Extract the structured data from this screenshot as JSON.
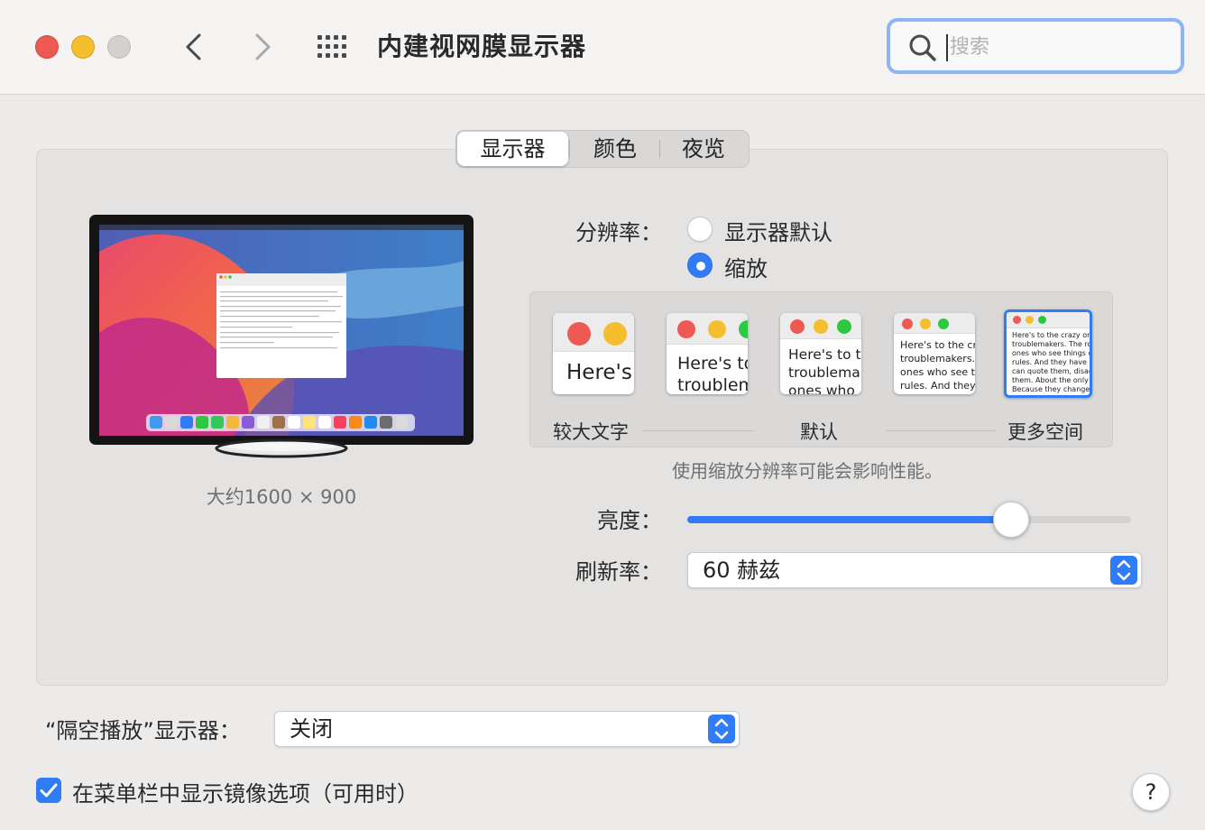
{
  "window": {
    "title": "内建视网膜显示器",
    "search_placeholder": "搜索"
  },
  "titlebar_icons": [
    "close-button",
    "minimize-button",
    "zoom-button",
    "back-icon",
    "forward-icon",
    "grid-icon"
  ],
  "tabs": [
    {
      "label": "显示器",
      "selected": true
    },
    {
      "label": "颜色",
      "selected": false
    },
    {
      "label": "夜览",
      "selected": false
    }
  ],
  "monitor": {
    "caption": "大约1600 × 900"
  },
  "resolution": {
    "label": "分辨率：",
    "options": [
      {
        "label": "显示器默认",
        "selected": false
      },
      {
        "label": "缩放",
        "selected": true
      }
    ],
    "scale_thumbs": [
      {
        "text": "Here's",
        "selected": false
      },
      {
        "text": "Here's to\ntroublem",
        "selected": false
      },
      {
        "text": "Here's to t\ntroublema\nones who",
        "selected": false
      },
      {
        "text": "Here's to the cr\ntroublemakers.\nones who see t\nrules. And they",
        "selected": false
      },
      {
        "text": "Here's to the crazy ones\ntroublemakers. The roun\nones who see things diff\nrules. And they have no\ncan quote them, disagre\nthem. About the only thi\nBecause they change th",
        "selected": true
      }
    ],
    "scale_labels": {
      "left": "较大文字",
      "middle": "默认",
      "right": "更多空间"
    },
    "note": "使用缩放分辨率可能会影响性能。"
  },
  "brightness": {
    "label": "亮度：",
    "value": 0.73
  },
  "refresh_rate": {
    "label": "刷新率：",
    "value": "60 赫兹"
  },
  "airplay": {
    "label": "“隔空播放”显示器：",
    "value": "关闭"
  },
  "mirror_option": {
    "label": "在菜单栏中显示镜像选项（可用时）",
    "checked": true
  },
  "help": {
    "label": "?"
  },
  "colors": {
    "accent": "#2F7CF6",
    "close": "#EE5A53",
    "minimize": "#F5BE2E",
    "background": "#ECEBEA"
  }
}
